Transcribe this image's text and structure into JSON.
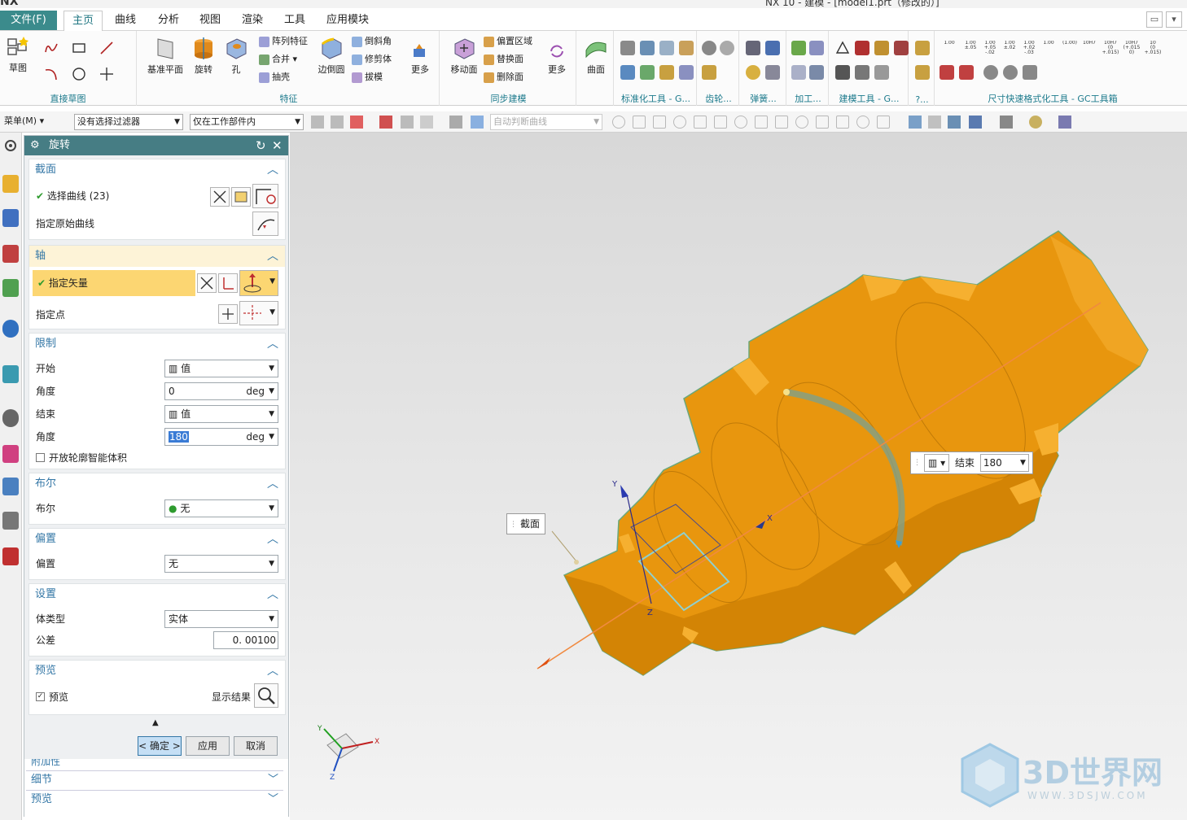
{
  "topstrip": {
    "app_logo": "NX",
    "title": "NX 10 - 建模 - [model1.prt（修改的）]"
  },
  "menubar": {
    "file_label": "文件(F)",
    "tabs": [
      "主页",
      "曲线",
      "分析",
      "视图",
      "渲染",
      "工具",
      "应用模块"
    ],
    "active_tab": "主页"
  },
  "ribbon": {
    "direct_sketch": {
      "label": "直接草图",
      "sketch_label": "草图"
    },
    "feature": {
      "label": "特征",
      "datum_plane": "基准平面",
      "revolve": "旋转",
      "hole": "孔",
      "pattern": "阵列特征",
      "unite": "合并",
      "shell": "抽壳",
      "edge_blend": "边倒圆",
      "chamfer": "倒斜角",
      "trim_body": "修剪体",
      "draft": "拔模",
      "more": "更多"
    },
    "sync": {
      "label": "同步建模",
      "move_face": "移动面",
      "offset_region": "偏置区域",
      "replace_face": "替换面",
      "delete_face": "删除面",
      "more": "更多"
    },
    "surface": {
      "label": "曲面"
    },
    "std_tools": {
      "label": "标准化工具 - G..."
    },
    "gear": {
      "label": "齿轮..."
    },
    "spring": {
      "label": "弹簧..."
    },
    "machining": {
      "label": "加工..."
    },
    "modeling_tools": {
      "label": "建模工具 - G..."
    },
    "misc": {
      "label": "?..."
    },
    "dim_tools": {
      "label": "尺寸快速格式化工具 - GC工具箱",
      "items": [
        "1.00",
        "1.00\n±.05",
        "1.00\n+.05\n-.02",
        "1.00\n±.02",
        "1.00\n+.02\n-.03",
        "1.00",
        "(1.00)",
        "10H7",
        "10H7\n(0\n+.015)",
        "10H7\n(+.015\n0)",
        "10\n(0\n+.015)"
      ]
    }
  },
  "toolbar2": {
    "menu_label": "菜单(M)",
    "filter": "没有选择过滤器",
    "scope": "仅在工作部件内",
    "curve_rule": "自动判断曲线"
  },
  "dialog": {
    "title": "旋转",
    "section_cross": {
      "title": "截面",
      "select_curve": "选择曲线 (23)",
      "specify_origin_curve": "指定原始曲线"
    },
    "section_axis": {
      "title": "轴",
      "specify_vector": "指定矢量",
      "specify_point": "指定点"
    },
    "section_limits": {
      "title": "限制",
      "start_label": "开始",
      "start_value": "值",
      "start_angle_label": "角度",
      "start_angle": "0",
      "end_label": "结束",
      "end_value": "值",
      "end_angle_label": "角度",
      "end_angle": "180",
      "unit": "deg",
      "open_profile": "开放轮廓智能体积"
    },
    "section_boolean": {
      "title": "布尔",
      "label": "布尔",
      "value": "无"
    },
    "section_offset": {
      "title": "偏置",
      "label": "偏置",
      "value": "无"
    },
    "section_settings": {
      "title": "设置",
      "body_type_label": "体类型",
      "body_type": "实体",
      "tolerance_label": "公差",
      "tolerance": "0. 00100"
    },
    "section_preview": {
      "title": "预览",
      "preview_label": "预览",
      "show_result": "显示结果"
    },
    "buttons": {
      "ok": "< 确定 >",
      "apply": "应用",
      "cancel": "取消"
    },
    "below": {
      "partial": "附加性",
      "detail": "细节",
      "preview": "预览"
    }
  },
  "viewport": {
    "section_tag": "截面",
    "end_tag_label": "结束",
    "end_tag_value": "180",
    "triad": {
      "x": "X",
      "y": "Y",
      "z": "Z"
    }
  },
  "watermark": {
    "brand": "3D世界网",
    "url": "WWW.3DSJW.COM"
  },
  "colors": {
    "body": "#e69a0a",
    "body_dark": "#c27c00",
    "teal": "#467d84",
    "accent_blue": "#3477a6",
    "highlight": "#fcd672"
  }
}
